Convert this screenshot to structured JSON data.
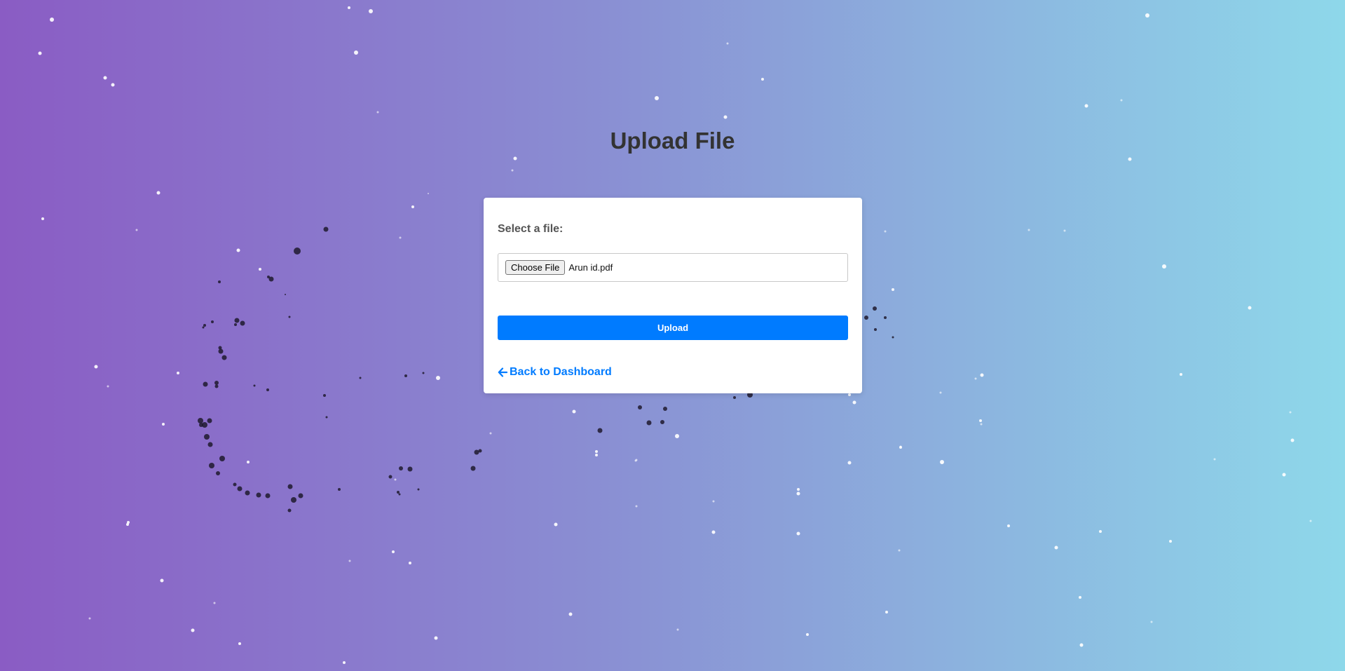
{
  "page": {
    "title": "Upload File"
  },
  "form": {
    "select_label": "Select a file:",
    "choose_button_label": "Choose File",
    "selected_file_name": "Arun id.pdf",
    "upload_button_label": "Upload",
    "back_link_label": "Back to Dashboard",
    "back_icon": "arrow-left-icon"
  },
  "theme": {
    "gradient_start": "#8a5cc4",
    "gradient_end": "#8ed8ea",
    "accent": "#007bff",
    "title_color": "#333333"
  }
}
